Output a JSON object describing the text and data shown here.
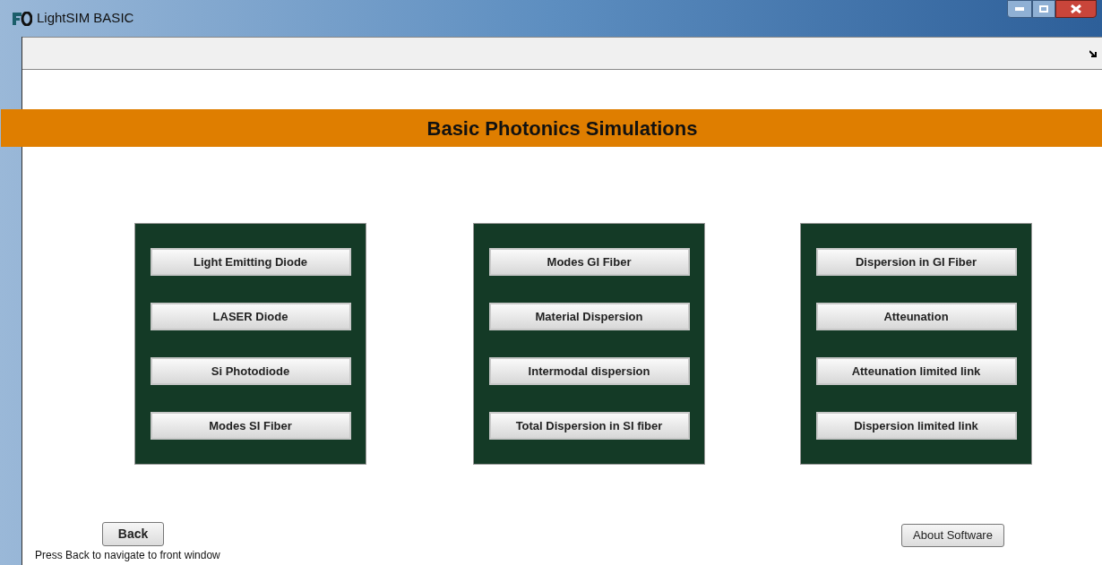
{
  "window": {
    "title": "LightSIM BASIC"
  },
  "banner": {
    "title": "Basic Photonics Simulations"
  },
  "panels": [
    {
      "buttons": [
        "Light Emitting Diode",
        "LASER Diode",
        "Si Photodiode",
        "Modes SI Fiber"
      ]
    },
    {
      "buttons": [
        "Modes GI Fiber",
        "Material Dispersion",
        "Intermodal dispersion",
        "Total Dispersion in SI fiber"
      ]
    },
    {
      "buttons": [
        "Dispersion in GI Fiber",
        "Atteunation",
        "Atteunation limited link",
        "Dispersion limited link"
      ]
    }
  ],
  "back_button": "Back",
  "hint": "Press Back to navigate to front window",
  "about_button": "About Software"
}
